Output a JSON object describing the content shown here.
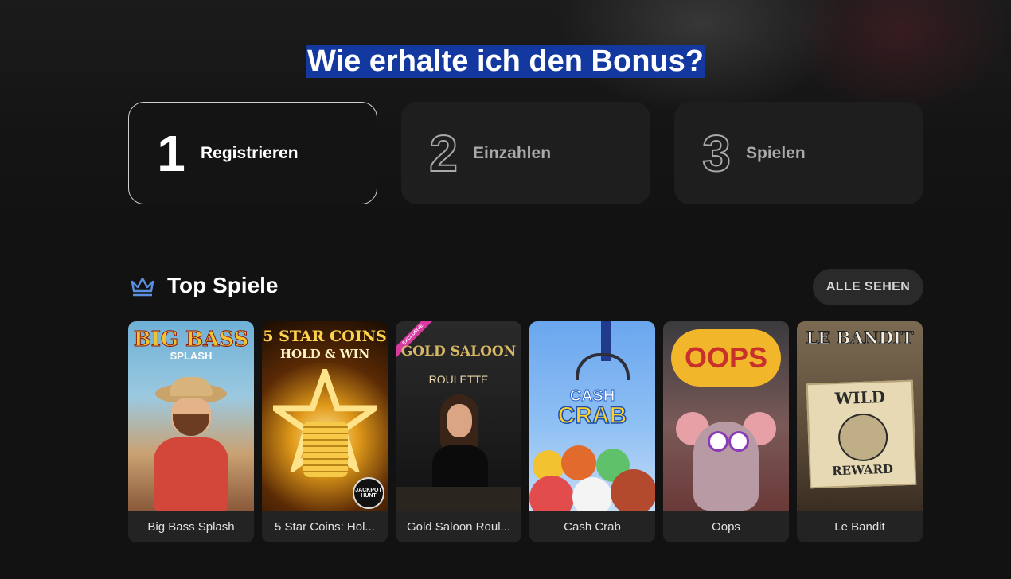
{
  "hero": {
    "title": "Wie erhalte ich den Bonus?"
  },
  "steps": [
    {
      "number": "1",
      "label": "Registrieren",
      "active": true
    },
    {
      "number": "2",
      "label": "Einzahlen",
      "active": false
    },
    {
      "number": "3",
      "label": "Spielen",
      "active": false
    }
  ],
  "top_games": {
    "title": "Top Spiele",
    "see_all": "ALLE SEHEN",
    "games": [
      {
        "name": "Big Bass Splash",
        "art_title": "BIG BASS",
        "art_subtitle": "SPLASH"
      },
      {
        "name": "5 Star Coins: Hol...",
        "art_title": "5 STAR COINS",
        "art_subtitle": "HOLD & WIN",
        "art_badge": "JACKPOT HUNT"
      },
      {
        "name": "Gold Saloon Roul...",
        "art_title": "GOLD SALOON",
        "art_subtitle": "ROULETTE",
        "art_badge": "EXCLUSIVE"
      },
      {
        "name": "Cash Crab",
        "art_title": "CASH",
        "art_subtitle": "CRAB"
      },
      {
        "name": "Oops",
        "art_title": "OOPS"
      },
      {
        "name": "Le Bandit",
        "art_title": "LE BANDIT",
        "art_subtitle": "WILD",
        "art_badge": "REWARD"
      }
    ]
  },
  "colors": {
    "background": "#121212",
    "title_highlight": "#1339a0",
    "crown_icon": "#5b8fe0"
  }
}
